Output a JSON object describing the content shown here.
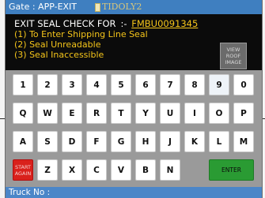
{
  "titlebar": {
    "gate_label": "Gate : APP-EXIT",
    "logo_text": "TIDOLY2"
  },
  "info": {
    "heading_prefix": "EXIT SEAL CHECK  FOR",
    "separator": ":-",
    "container_number": "FMBU0091345",
    "options": [
      "(1) To Enter Shipping Line Seal",
      "(2) Seal Unreadable",
      "(3) Seal Inaccessible"
    ],
    "roof_button_label": "VIEW\nROOF\nIMAGE"
  },
  "keyboard": {
    "row1": [
      "1",
      "2",
      "3",
      "4",
      "5",
      "6",
      "7",
      "8",
      "9",
      "0"
    ],
    "row2": [
      "Q",
      "W",
      "E",
      "R",
      "T",
      "Y",
      "U",
      "I",
      "O",
      "P"
    ],
    "row3": [
      "A",
      "S",
      "D",
      "F",
      "G",
      "H",
      "J",
      "K",
      "L",
      "M"
    ],
    "row4_letters": [
      "Z",
      "X",
      "C",
      "V",
      "B",
      "N"
    ],
    "start_label": "START\nAGAIN",
    "enter_label": "ENTER",
    "highlighted_key": "9"
  },
  "status": {
    "truck_label": "Truck No :"
  },
  "colors": {
    "title_bg": "#3f7fc0",
    "info_bg": "#0b0b0b",
    "option_text": "#f5c51a",
    "start_key": "#d9211c",
    "enter_key": "#2a9b33"
  }
}
